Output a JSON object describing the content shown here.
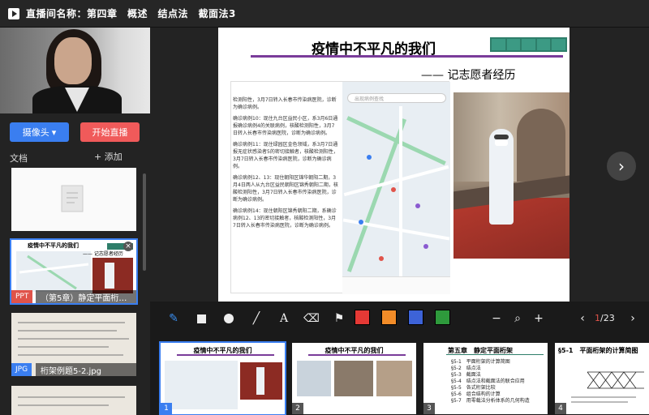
{
  "window": {
    "title": "直播间名称：第四章　概述　结点法　截面法3"
  },
  "sidebar": {
    "camera_button": "摄像头 ▾",
    "live_button": "开始直播",
    "docs_label": "文档",
    "add_label": "+ 添加",
    "docs": [
      {
        "type_tag": "",
        "caption": ""
      },
      {
        "type_tag": "PPT",
        "caption": "（第5章）静定平面桁…"
      },
      {
        "type_tag": "JPG",
        "caption": "桁架例题5-2.jpg"
      },
      {
        "type_tag": "",
        "caption": ""
      }
    ]
  },
  "slide": {
    "title": "疫情中不平凡的我们",
    "subtitle": "—— 记志愿者经历",
    "map_search_placeholder": "出现病例查找",
    "case_text": [
      "检测阳性，3月7日转入长春市传染病医院，诊断为确诊病例。",
      "确诊病例10：现住九台区益民小区，系3月6日通报确诊病例4的关联病例，核酸检测阳性，3月7日转入长春市传染病医院，诊断为确诊病例。",
      "确诊病例11：现住绿园区金色领域，系3月7日通报无症状感染者5的密切接触者，核酸检测阳性，3月7日转入长春市传染病医院，诊断为确诊病例。",
      "确诊病例12、13：现住朝阳区锦华朝阳二期，3月4日两人从九台区益民朝阳区锦秀朝阳二期，核酸检测阳性，3月7日转入长春市传染病医院，诊断为确诊病例。",
      "确诊病例14：现住朝阳区锦秀朝阳二期，系确诊病例12、13的密切接触者，核酸检测阳性，3月7日转入长春市传染病医院，诊断为确诊病例。"
    ]
  },
  "toolbar": {
    "colors": [
      "#e53935",
      "#f28c28",
      "#3d63d8",
      "#2e9a3c"
    ],
    "page_current": "1",
    "page_total": "/23",
    "minus": "−",
    "plus": "+"
  },
  "thumbnails": [
    {
      "num": "1",
      "title": "疫情中不平凡的我们",
      "lines": []
    },
    {
      "num": "2",
      "title": "疫情中不平凡的我们",
      "lines": []
    },
    {
      "num": "3",
      "title": "第五章　静定平面桁架",
      "lines": [
        "§5-1　平面桁架的计算简图",
        "§5-2　结点法",
        "§5-3　截面法",
        "§5-4　结点法和截面法的联合应用",
        "§5-5　各式桁架比较",
        "§5-6　组合结构的计算",
        "§5-7　用零载法分析体系的几何构造"
      ]
    },
    {
      "num": "4",
      "title": "§5-1　平面桁架的计算简图",
      "lines": []
    }
  ]
}
